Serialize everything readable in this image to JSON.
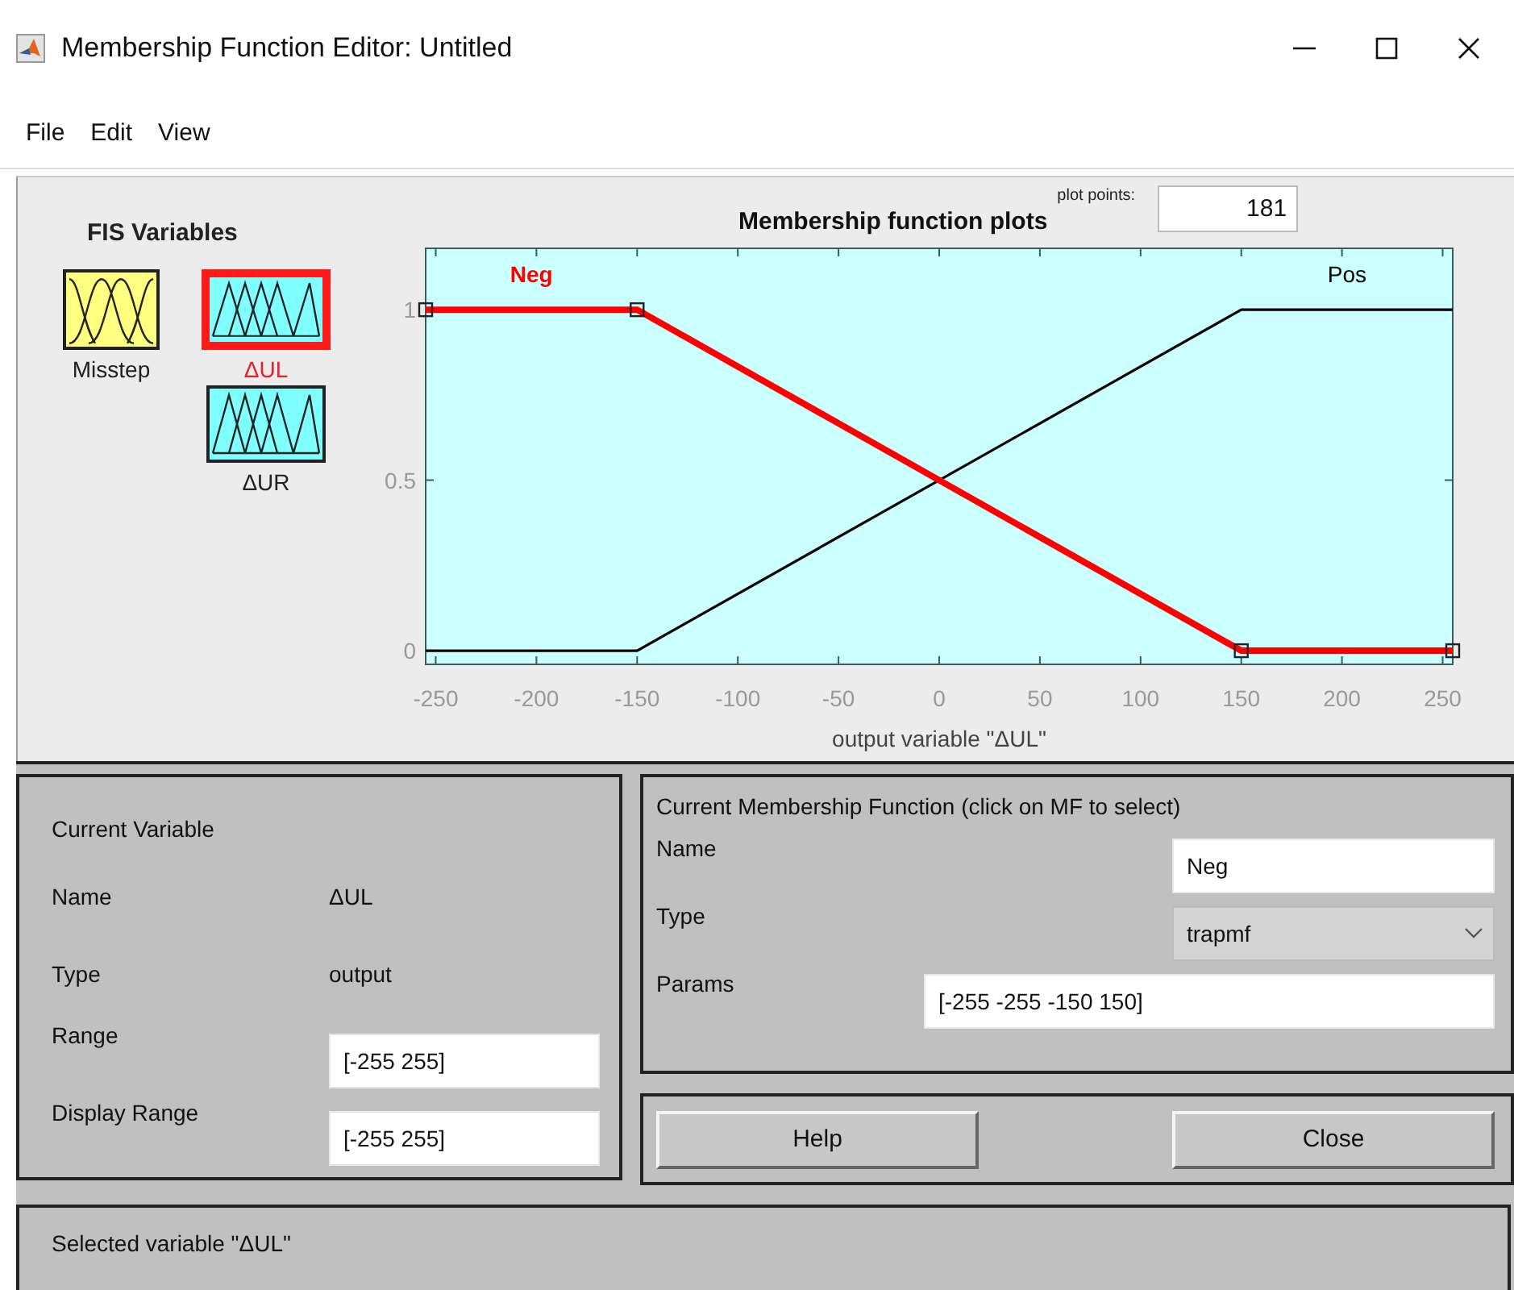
{
  "window": {
    "title": "Membership Function Editor: Untitled"
  },
  "menu": [
    "File",
    "Edit",
    "View"
  ],
  "fis_variables": {
    "title": "FIS Variables",
    "items": [
      {
        "name": "Misstep",
        "kind": "input",
        "selected": false
      },
      {
        "name": "ΔUL",
        "kind": "output",
        "selected": true
      },
      {
        "name": "ΔUR",
        "kind": "output",
        "selected": false
      }
    ]
  },
  "plot": {
    "plot_points_label": "plot points:",
    "plot_points": "181",
    "chart_data": {
      "type": "line",
      "title": "Membership function plots",
      "xlabel": "output variable \"ΔUL\"",
      "x": [
        -255,
        -150,
        150,
        255
      ],
      "series": [
        {
          "name": "Neg",
          "color": "#ff0000",
          "marker": "square",
          "values": [
            1,
            1,
            0,
            0
          ]
        },
        {
          "name": "Pos",
          "color": "#000000",
          "values": [
            0,
            0,
            1,
            1
          ]
        }
      ],
      "xlim": [
        -255,
        255
      ],
      "ylim": [
        -0.04,
        1.18
      ],
      "xticks": [
        -250,
        -200,
        -150,
        -100,
        -50,
        0,
        50,
        100,
        150,
        200,
        250
      ],
      "yticks": [
        0,
        0.5,
        1
      ]
    },
    "membership_functions": [
      {
        "selected": true
      },
      {
        "selected": false
      }
    ]
  },
  "current_variable": {
    "title": "Current Variable",
    "fields": [
      {
        "label": "Name",
        "value": "ΔUL",
        "kind": "text"
      },
      {
        "label": "Type",
        "value": "output",
        "kind": "text"
      },
      {
        "label": "Range",
        "value": "[-255 255]",
        "kind": "input"
      },
      {
        "label": "Display Range",
        "value": "[-255 255]",
        "kind": "input"
      }
    ]
  },
  "current_mf": {
    "title": "Current Membership Function (click on MF to select)",
    "name_label": "Name",
    "name": "Neg",
    "type_label": "Type",
    "type": "trapmf",
    "params_label": "Params",
    "params": "[-255 -255 -150 150]"
  },
  "buttons": [
    "Help",
    "Close"
  ],
  "status": "Selected variable \"ΔUL\""
}
